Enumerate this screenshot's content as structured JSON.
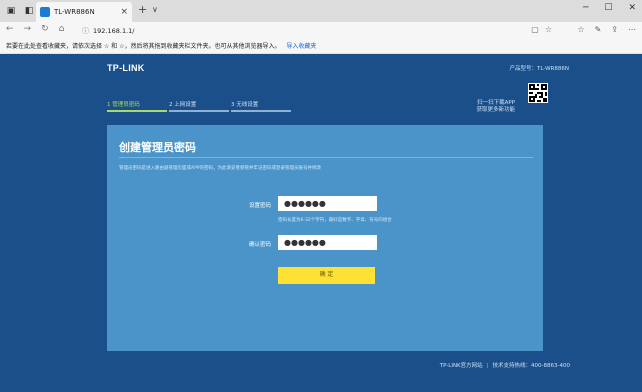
{
  "browser": {
    "tab_title": "TL-WR886N",
    "tab_close": "×",
    "new_tab": "+",
    "tab_arrow": "∨",
    "url": "192.168.1.1/",
    "bookmark_text": "若要在此处查看收藏夹，请依次选择 ☆ 和 ☆，然后将其拖到收藏夹栏文件夹。也可从其他浏览器导入。",
    "bookmark_link": "导入收藏夹"
  },
  "page": {
    "logo": "TP-LINK",
    "model": "产品型号：TL-WR886N",
    "steps": [
      "1 管理员密码",
      "2 上网设置",
      "3 无线设置"
    ],
    "app_line1": "扫一扫下载APP",
    "app_line2": "获取更多新功能",
    "panel_title": "创建管理员密码",
    "panel_desc": "管理员密码是进入路由器管理页面或APP的密码，为此请妥善保管并牢记密码或登录管理员账号并修改",
    "password_label": "设置密码",
    "password_value": "●●●●●●",
    "password_hint": "密码长度为6-32个字符，最好是数字、字母、符号的组合",
    "confirm_label": "确认密码",
    "confirm_value": "●●●●●●",
    "confirm_button": "确 定",
    "footer_site": "TP-LINK官方网站",
    "footer_separator": "|",
    "footer_support": "技术支持热线：400-8863-400"
  },
  "colors": {
    "page_bg": "#1a4f8a",
    "panel_bg": "#4a94c9",
    "button_bg": "#ffe035",
    "active_step": "#a9d96b"
  }
}
